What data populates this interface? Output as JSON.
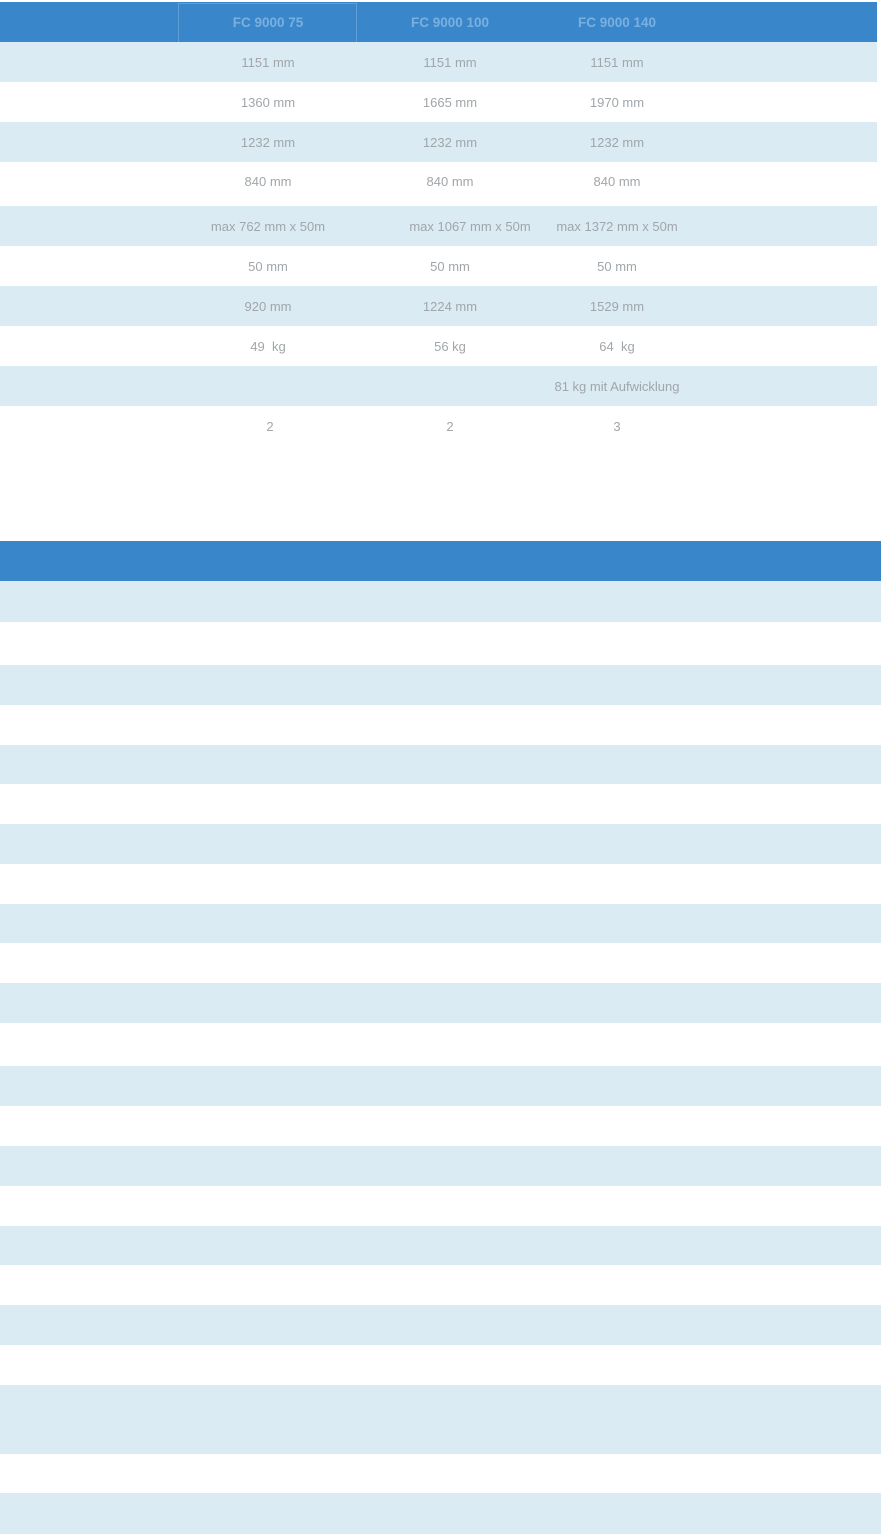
{
  "table1": {
    "columns": [
      "FC 9000 75",
      "FC 9000 100",
      "FC 9000 140"
    ],
    "rows": [
      [
        "1151 mm",
        "1151 mm",
        "1151 mm"
      ],
      [
        "1360 mm",
        "1665 mm",
        "1970 mm"
      ],
      [
        "1232 mm",
        "1232 mm",
        "1232 mm"
      ],
      [
        "840 mm",
        "840 mm",
        "840 mm"
      ],
      [
        "max 762 mm x 50m",
        "max 1067 mm x 50m",
        "max 1372 mm x 50m"
      ],
      [
        "50 mm",
        "50 mm",
        "50 mm"
      ],
      [
        "920 mm",
        "1224 mm",
        "1529 mm"
      ],
      [
        "49  kg",
        "56 kg",
        "64  kg"
      ],
      [
        "",
        "",
        "81 kg mit Aufwicklung"
      ],
      [
        "2",
        "2",
        "3"
      ]
    ]
  },
  "colors": {
    "header_blue": "#3a86cb",
    "stripe_light_blue": "#dbebf4",
    "cell_text_gray": "#a0a6aa"
  }
}
